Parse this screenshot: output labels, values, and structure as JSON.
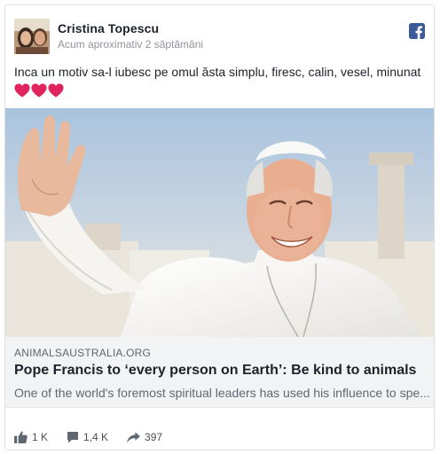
{
  "post": {
    "author": "Cristina Topescu",
    "timestamp": "Acum aproximativ 2 săptămâni",
    "text": "Inca un motiv sa-l iubesc pe omul ăsta simplu, firesc, calin, vesel, minunat",
    "heart_icons": [
      "heart-icon",
      "heart-icon",
      "heart-icon"
    ],
    "heart_color": "#e0245e"
  },
  "link": {
    "domain": "ANIMALSAUSTRALIA.ORG",
    "title": "Pope Francis to ‘every person on Earth’: Be kind to animals",
    "description": "One of the world's foremost spiritual leaders has used his influence to spe..."
  },
  "actions": {
    "likes": "1 K",
    "comments": "1,4 K",
    "shares": "397"
  },
  "colors": {
    "facebook_blue": "#3b5998",
    "link_background": "#f2f3f5",
    "secondary_text": "#90949c"
  }
}
